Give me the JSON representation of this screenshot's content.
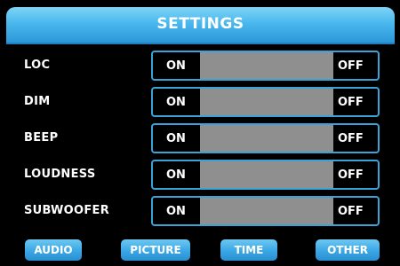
{
  "header": {
    "title": "SETTINGS"
  },
  "settings": [
    {
      "label": "LOC",
      "on_label": "ON",
      "off_label": "OFF"
    },
    {
      "label": "DIM",
      "on_label": "ON",
      "off_label": "OFF"
    },
    {
      "label": "BEEP",
      "on_label": "ON",
      "off_label": "OFF"
    },
    {
      "label": "LOUDNESS",
      "on_label": "ON",
      "off_label": "OFF"
    },
    {
      "label": "SUBWOOFER",
      "on_label": "ON",
      "off_label": "OFF"
    }
  ],
  "tabs": [
    {
      "label": "AUDIO"
    },
    {
      "label": "PICTURE"
    },
    {
      "label": "TIME"
    },
    {
      "label": "OTHER"
    }
  ],
  "colors": {
    "accent": "#3aa3d8",
    "header_top": "#7fd4f6",
    "track": "#8f8f8f",
    "background": "#000000"
  }
}
